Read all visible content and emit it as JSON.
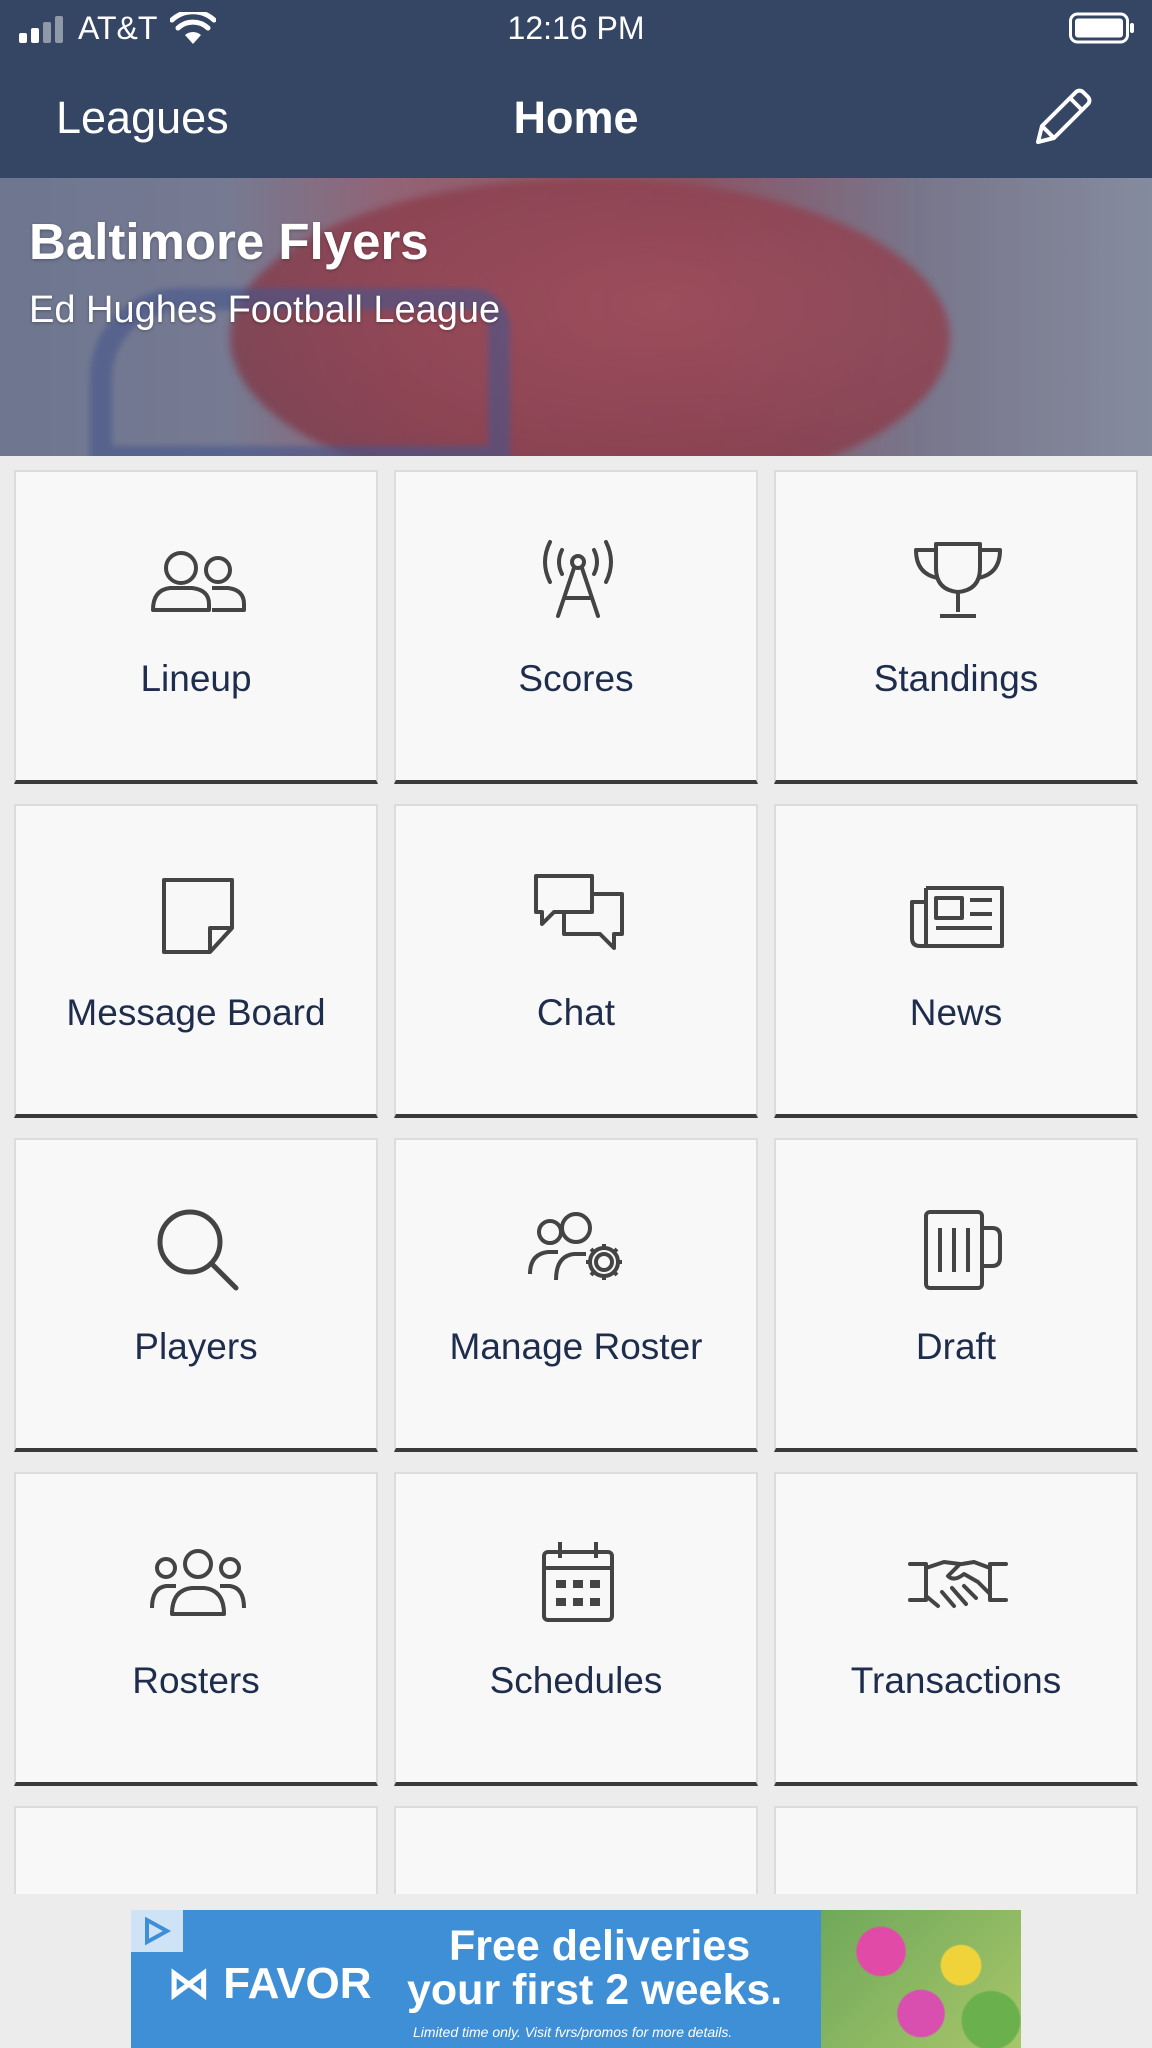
{
  "status_bar": {
    "carrier": "AT&T",
    "time": "12:16 PM"
  },
  "nav": {
    "back_label": "Leagues",
    "title": "Home",
    "edit_icon": "pencil-icon"
  },
  "banner": {
    "team": "Baltimore Flyers",
    "league": "Ed Hughes Football League"
  },
  "tiles": [
    {
      "label": "Lineup",
      "icon": "lineup-people-icon"
    },
    {
      "label": "Scores",
      "icon": "broadcast-antenna-icon"
    },
    {
      "label": "Standings",
      "icon": "trophy-icon"
    },
    {
      "label": "Message Board",
      "icon": "sticky-note-icon"
    },
    {
      "label": "Chat",
      "icon": "chat-bubbles-icon"
    },
    {
      "label": "News",
      "icon": "newspaper-icon"
    },
    {
      "label": "Players",
      "icon": "search-icon"
    },
    {
      "label": "Manage Roster",
      "icon": "people-gear-icon"
    },
    {
      "label": "Draft",
      "icon": "draft-mug-icon"
    },
    {
      "label": "Rosters",
      "icon": "group-people-icon"
    },
    {
      "label": "Schedules",
      "icon": "calendar-icon"
    },
    {
      "label": "Transactions",
      "icon": "handshake-icon"
    }
  ],
  "ad": {
    "brand": "FAVOR",
    "line1": "Free deliveries",
    "line2": "your first 2 weeks.",
    "fine_print": "Limited time only. Visit fvrs/promos for more details."
  },
  "colors": {
    "nav_bar": "#354564",
    "tile_text": "#1f2d4d",
    "icon_stroke": "#444444",
    "ad_background": "#3f8fd6"
  }
}
